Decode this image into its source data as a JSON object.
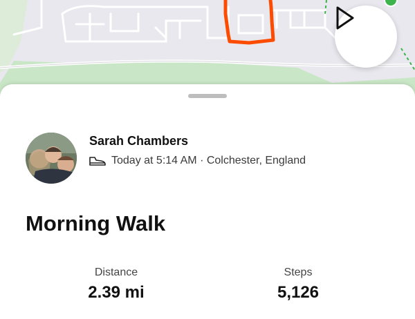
{
  "colors": {
    "route": "#fc4c02",
    "map_background": "#e9e8ee",
    "park": "#c9e7c6",
    "text_primary": "#111111",
    "text_secondary": "#3a3a3a"
  },
  "map": {
    "play_icon": "play-icon"
  },
  "activity": {
    "athlete_name": "Sarah Chambers",
    "sport_icon": "shoe-icon",
    "meta": "Today at 5:14 AM · Colchester, England",
    "title": "Morning Walk"
  },
  "stats": [
    {
      "label": "Distance",
      "value": "2.39 mi"
    },
    {
      "label": "Steps",
      "value": "5,126"
    }
  ]
}
